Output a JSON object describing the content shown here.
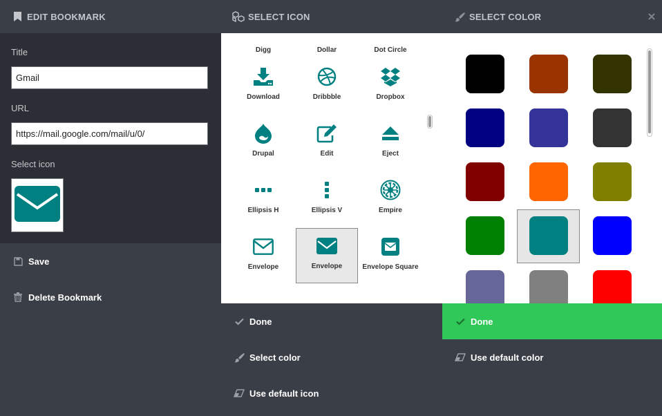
{
  "edit": {
    "header": "EDIT BOOKMARK",
    "title_label": "Title",
    "title_value": "Gmail",
    "url_label": "URL",
    "url_value": "https://mail.google.com/mail/u/0/",
    "icon_label": "Select icon",
    "selected_icon": "envelope-icon",
    "save_label": "Save",
    "delete_label": "Delete Bookmark"
  },
  "icons": {
    "header": "SELECT ICON",
    "clipped_row": [
      "Digg",
      "Dollar",
      "Dot Circle"
    ],
    "items": [
      {
        "label": "Download",
        "icon": "download-icon"
      },
      {
        "label": "Dribbble",
        "icon": "dribbble-icon"
      },
      {
        "label": "Dropbox",
        "icon": "dropbox-icon"
      },
      {
        "label": "Drupal",
        "icon": "drupal-icon"
      },
      {
        "label": "Edit",
        "icon": "edit-icon"
      },
      {
        "label": "Eject",
        "icon": "eject-icon"
      },
      {
        "label": "Ellipsis H",
        "icon": "ellipsis-h-icon"
      },
      {
        "label": "Ellipsis V",
        "icon": "ellipsis-v-icon"
      },
      {
        "label": "Empire",
        "icon": "empire-icon"
      },
      {
        "label": "Envelope",
        "icon": "envelope-o-icon"
      },
      {
        "label": "Envelope",
        "icon": "envelope-icon",
        "selected": true
      },
      {
        "label": "Envelope Square",
        "icon": "envelope-square-icon"
      }
    ],
    "done_label": "Done",
    "select_color_label": "Select color",
    "default_icon_label": "Use default icon",
    "icon_color": "#008080"
  },
  "colors": {
    "header": "SELECT COLOR",
    "swatches": [
      "#000000",
      "#993300",
      "#333300",
      "#000080",
      "#333399",
      "#333333",
      "#800000",
      "#ff6600",
      "#808000",
      "#008000",
      "#008080",
      "#0000ff",
      "#666699",
      "#808080",
      "#ff0000"
    ],
    "selected": "#008080",
    "done_label": "Done",
    "default_color_label": "Use default color"
  }
}
